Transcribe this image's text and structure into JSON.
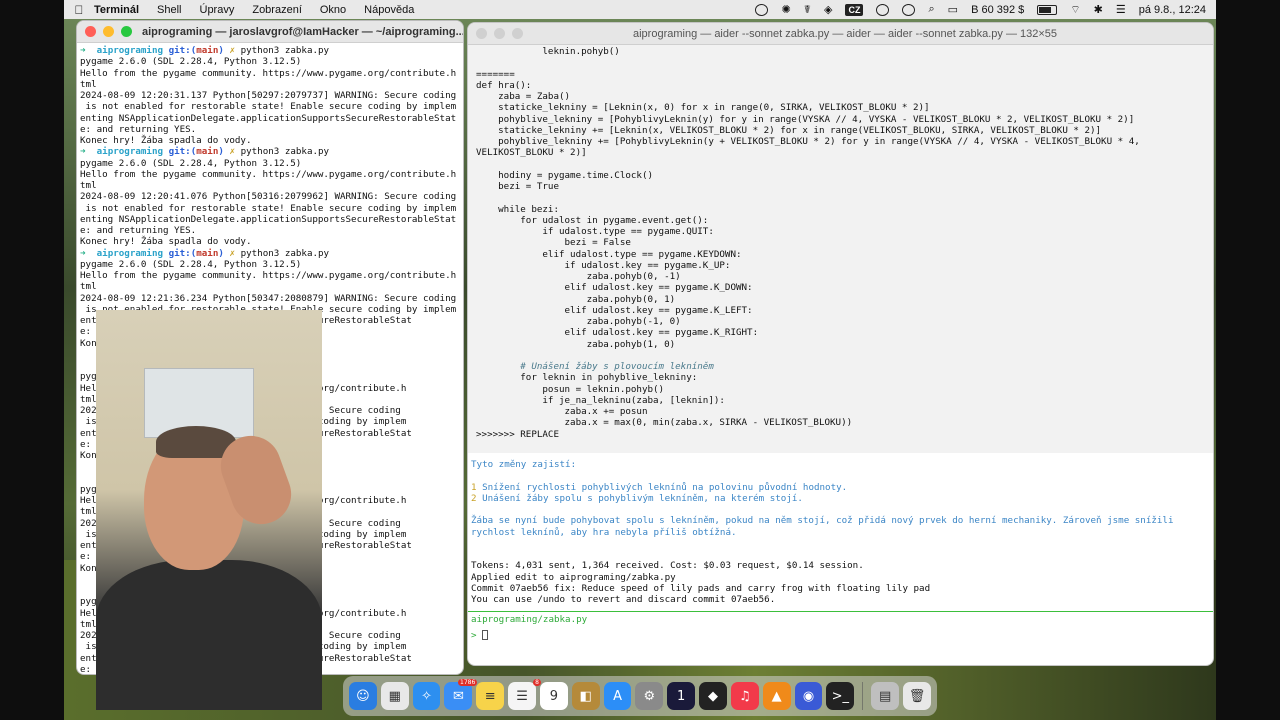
{
  "menubar": {
    "app_name": "Terminál",
    "menus": [
      "Shell",
      "Úpravy",
      "Zobrazení",
      "Okno",
      "Nápověda"
    ],
    "language": "CZ",
    "balance": "B 60 392 $",
    "datetime": "pá 9.8., 12:24"
  },
  "left_terminal": {
    "title": "aiprograming — jaroslavgrof@IamHacker — ~/aiprograming...",
    "prompt": {
      "arrow": "➜",
      "dir": "aiprograming",
      "git": "git:(",
      "branch": "main",
      "git_close": ")",
      "x": "✗"
    },
    "command": "python3 zabka.py",
    "session_lines_1": [
      "pygame 2.6.0 (SDL 2.28.4, Python 3.12.5)",
      "Hello from the pygame community. https://www.pygame.org/contribute.h",
      "tml",
      "2024-08-09 12:20:31.137 Python[50297:2079737] WARNING: Secure coding",
      " is not enabled for restorable state! Enable secure coding by implem",
      "enting NSApplicationDelegate.applicationSupportsSecureRestorableStat",
      "e: and returning YES.",
      "Konec hry! Žába spadla do vody."
    ],
    "session_lines_2": [
      "pygame 2.6.0 (SDL 2.28.4, Python 3.12.5)",
      "Hello from the pygame community. https://www.pygame.org/contribute.h",
      "tml",
      "2024-08-09 12:20:41.076 Python[50316:2079962] WARNING: Secure coding",
      " is not enabled for restorable state! Enable secure coding by implem",
      "enting NSApplicationDelegate.applicationSupportsSecureRestorableStat",
      "e: and returning YES.",
      "Konec hry! Žába spadla do vody."
    ],
    "session_lines_3": [
      "pygame 2.6.0 (SDL 2.28.4, Python 3.12.5)",
      "Hello from the pygame community. https://www.pygame.org/contribute.h",
      "tml",
      "2024-08-09 12:21:36.234 Python[50347:2080879] WARNING: Secure coding",
      " is not enabled for restorable state! Enable secure coding by implem",
      "ent                               pportsSecureRestorableStat",
      "e:",
      "Kon",
      "",
      "                                  ",
      "pyg",
      "Hel                               w.pygame.org/contribute.h",
      "tml",
      "202                               ] WARNING: Secure coding",
      " is                               e secure coding by implem",
      "ent                               pportsSecureRestorableStat",
      "e:",
      "Kon",
      "",
      "",
      "pyg",
      "Hel                               w.pygame.org/contribute.h",
      "tml",
      "202                               ] WARNING: Secure coding",
      " is                               e secure coding by implem",
      "ent                               pportsSecureRestorableStat",
      "e:",
      "Kon",
      "",
      "",
      "pyg",
      "Hel                               w.pygame.org/contribute.h",
      "tml",
      "202                               ] WARNING: Secure coding",
      " is                               e secure coding by implem",
      "ent                               pportsSecureRestorableStat",
      "e:",
      "Kon",
      "➜"
    ]
  },
  "right_terminal": {
    "title": "aiprograming — aider --sonnet zabka.py — aider — aider --sonnet zabka.py — 132×55",
    "code_lines": [
      "            leknin.pohyb()",
      "",
      "=======",
      "def hra():",
      "    zaba = Zaba()",
      "    staticke_lekniny = [Leknin(x, 0) for x in range(0, SIRKA, VELIKOST_BLOKU * 2)]",
      "    pohyblive_lekniny = [PohyblivyLeknin(y) for y in range(VYSKA // 4, VYSKA - VELIKOST_BLOKU * 2, VELIKOST_BLOKU * 2)]",
      "    staticke_lekniny += [Leknin(x, VELIKOST_BLOKU * 2) for x in range(VELIKOST_BLOKU, SIRKA, VELIKOST_BLOKU * 2)]",
      "    pohyblive_lekniny += [PohyblivyLeknin(y + VELIKOST_BLOKU * 2) for y in range(VYSKA // 4, VYSKA - VELIKOST_BLOKU * 4,",
      "VELIKOST_BLOKU * 2)]",
      "",
      "    hodiny = pygame.time.Clock()",
      "    bezi = True",
      "",
      "    while bezi:",
      "        for udalost in pygame.event.get():",
      "            if udalost.type == pygame.QUIT:",
      "                bezi = False",
      "            elif udalost.type == pygame.KEYDOWN:",
      "                if udalost.key == pygame.K_UP:",
      "                    zaba.pohyb(0, -1)",
      "                elif udalost.key == pygame.K_DOWN:",
      "                    zaba.pohyb(0, 1)",
      "                elif udalost.key == pygame.K_LEFT:",
      "                    zaba.pohyb(-1, 0)",
      "                elif udalost.key == pygame.K_RIGHT:",
      "                    zaba.pohyb(1, 0)",
      "",
      "        # Unášení žáby s plovoucím lekníněm",
      "        for leknin in pohyblive_lekniny:",
      "            posun = leknin.pohyb()",
      "            if je_na_lekninu(zaba, [leknin]):",
      "                zaba.x += posun",
      "                zaba.x = max(0, min(zaba.x, SIRKA - VELIKOST_BLOKU))",
      ">>>>>>> REPLACE"
    ],
    "changes_intro": "Tyto změny zajistí:",
    "changes": [
      {
        "num": "1",
        "text": "Snížení rychlosti pohyblivých leknínů na polovinu původní hodnoty."
      },
      {
        "num": "2",
        "text": "Unášení žáby spolu s pohyblivým lekníněm, na kterém stojí."
      }
    ],
    "summary_lines": [
      "Žába se nyní bude pohybovat spolu s lekníněm, pokud na něm stojí, což přidá nový prvek do herní mechaniky. Zároveň jsme snížili",
      "rychlost leknínů, aby hra nebyla příliš obtížná."
    ],
    "status_lines": [
      "Tokens: 4,031 sent, 1,364 received. Cost: $0.03 request, $0.14 session.",
      "Applied edit to aiprograming/zabka.py",
      "Commit 07aeb56 fix: Reduce speed of lily pads and carry frog with floating lily pad",
      "You can use /undo to revert and discard commit 07aeb56."
    ],
    "file_label": "aiprograming/zabka.py",
    "input_prompt": ">"
  },
  "dock": {
    "mail_badge": "1786",
    "reminders_badge": "8",
    "calendar_month": "SRP",
    "calendar_day": "9",
    "items": [
      {
        "name": "finder-icon",
        "glyph": "☺",
        "color": "#2a7de1"
      },
      {
        "name": "launchpad-icon",
        "glyph": "▦",
        "color": "#e8e8e8"
      },
      {
        "name": "safari-icon",
        "glyph": "✧",
        "color": "#2d8ff0"
      },
      {
        "name": "mail-icon",
        "glyph": "✉",
        "color": "#3a8ef5"
      },
      {
        "name": "notes-icon",
        "glyph": "≡",
        "color": "#f7d34a"
      },
      {
        "name": "reminders-icon",
        "glyph": "☰",
        "color": "#f5f5f5"
      },
      {
        "name": "calendar-icon",
        "glyph": "9",
        "color": "#ffffff"
      },
      {
        "name": "books-icon",
        "glyph": "◧",
        "color": "#b58a3a"
      },
      {
        "name": "app-store-icon",
        "glyph": "A",
        "color": "#2c8ef7"
      },
      {
        "name": "settings-icon",
        "glyph": "⚙",
        "color": "#8a8a8a"
      },
      {
        "name": "password-icon",
        "glyph": "1",
        "color": "#1a1a3a"
      },
      {
        "name": "inkscape-icon",
        "glyph": "◆",
        "color": "#222"
      },
      {
        "name": "music-icon",
        "glyph": "♫",
        "color": "#f23a4a"
      },
      {
        "name": "vlc-icon",
        "glyph": "▲",
        "color": "#f08a1a"
      },
      {
        "name": "preview-icon",
        "glyph": "◉",
        "color": "#3a5ad6"
      },
      {
        "name": "terminal-icon",
        "glyph": ">_",
        "color": "#222"
      }
    ],
    "right_items": [
      {
        "name": "downloads-stack-icon",
        "glyph": "▤",
        "color": "#bfbfbf"
      },
      {
        "name": "trash-icon",
        "glyph": "🗑",
        "color": "#e8e8e8"
      }
    ]
  }
}
